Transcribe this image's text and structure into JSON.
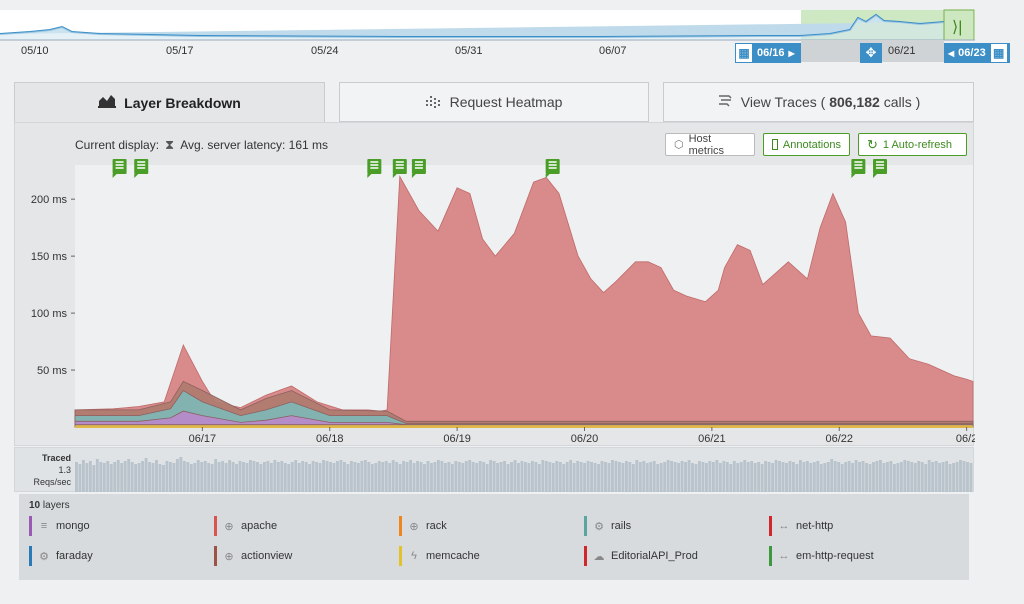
{
  "timeline": {
    "dates": [
      "05/10",
      "05/17",
      "05/24",
      "05/31",
      "06/07",
      "06/21"
    ],
    "range_start": "06/16",
    "range_end": "06/23",
    "expand_icon": "expand-arrows-icon"
  },
  "tabs": [
    {
      "label": "Layer Breakdown",
      "icon": "layers-icon"
    },
    {
      "label": "Request Heatmap",
      "icon": "heatmap-icon"
    },
    {
      "label": "View Traces (",
      "count": "806,182",
      "suffix": "calls )",
      "icon": "traces-icon"
    }
  ],
  "toolbar": {
    "display_label": "Current display:",
    "display_value": "Avg. server latency: 161 ms",
    "host_metrics": "Host metrics",
    "annotations": "Annotations",
    "auto_refresh": "1 Auto-refresh"
  },
  "chart_data": {
    "type": "area",
    "y_ticks": [
      "200 ms",
      "150 ms",
      "100 ms",
      "50 ms"
    ],
    "ylim": [
      0,
      230
    ],
    "x_ticks": [
      "06/17",
      "06/18",
      "06/19",
      "06/20",
      "06/21",
      "06/22",
      "06/2"
    ],
    "series": [
      {
        "name": "apache",
        "color": "#d98a8a",
        "x": [
          0,
          0.3,
          0.5,
          0.7,
          0.85,
          1.0,
          1.1,
          1.3,
          1.5,
          1.7,
          1.9,
          2.1,
          2.2,
          2.3,
          2.4,
          2.45,
          2.55,
          2.7,
          2.85,
          3.0,
          3.1,
          3.2,
          3.3,
          3.45,
          3.6,
          3.7,
          3.8,
          3.95,
          4.05,
          4.15,
          4.25,
          4.4,
          4.5,
          4.6,
          4.7,
          4.8,
          4.95,
          5.05,
          5.1,
          5.2,
          5.3,
          5.4,
          5.5,
          5.6,
          5.75,
          5.85,
          5.95,
          6.05,
          6.15,
          6.25,
          6.4,
          6.55,
          6.7,
          6.8,
          6.9,
          7.0,
          7.05
        ],
        "values": [
          15,
          16,
          18,
          22,
          72,
          40,
          22,
          17,
          28,
          36,
          22,
          15,
          15,
          15,
          14,
          15,
          220,
          190,
          172,
          210,
          205,
          165,
          150,
          170,
          215,
          219,
          205,
          150,
          130,
          118,
          128,
          145,
          145,
          140,
          120,
          115,
          110,
          120,
          140,
          160,
          155,
          125,
          135,
          145,
          130,
          175,
          205,
          180,
          100,
          80,
          78,
          60,
          55,
          50,
          45,
          42,
          40
        ]
      },
      {
        "name": "actionview",
        "color": "#b07b70",
        "x": [
          0,
          0.5,
          0.75,
          0.85,
          1.0,
          1.3,
          1.5,
          1.7,
          2.0,
          2.45,
          2.6,
          7.05
        ],
        "values": [
          15,
          15,
          22,
          40,
          32,
          15,
          25,
          32,
          15,
          14,
          5,
          5
        ]
      },
      {
        "name": "rails",
        "color": "#7fb6b4",
        "x": [
          0,
          0.5,
          0.75,
          0.85,
          1.0,
          1.3,
          1.5,
          1.7,
          2.0,
          2.45,
          2.6,
          7.05
        ],
        "values": [
          10,
          10,
          16,
          32,
          22,
          10,
          15,
          22,
          10,
          10,
          3,
          3
        ]
      },
      {
        "name": "mongo",
        "color": "#b58ac9",
        "x": [
          0,
          0.5,
          0.75,
          0.85,
          1.0,
          1.3,
          1.5,
          1.7,
          2.0,
          2.45,
          2.6,
          7.05
        ],
        "values": [
          5,
          5,
          8,
          14,
          10,
          4,
          6,
          10,
          4,
          4,
          2,
          2
        ]
      },
      {
        "name": "memcache",
        "color": "#e0b84a",
        "x": [
          0,
          7.05
        ],
        "values": [
          2,
          2
        ]
      }
    ],
    "annotation_x": [
      0.35,
      0.52,
      2.35,
      2.55,
      2.7,
      3.75,
      6.15,
      6.32
    ]
  },
  "traced": {
    "label": "Traced",
    "value": "1.3",
    "unit": "Reqs/sec",
    "bars": [
      30,
      28,
      32,
      29,
      31,
      27,
      33,
      30,
      29,
      31,
      28,
      30,
      32,
      29,
      31,
      33,
      30,
      28,
      29,
      31,
      34,
      30,
      29,
      32,
      28,
      27,
      31,
      30,
      29,
      33,
      35,
      31,
      30,
      28,
      29,
      32,
      30,
      31,
      29,
      28,
      33,
      30,
      31,
      29,
      32,
      30,
      28,
      31,
      30,
      29,
      32,
      31,
      30,
      28,
      30,
      31,
      29,
      32,
      30,
      31,
      29,
      28,
      30,
      32,
      29,
      31,
      30,
      28,
      31,
      30,
      29,
      32,
      31,
      30,
      29,
      31,
      32,
      30,
      28,
      31,
      30,
      29,
      31,
      32,
      30,
      28,
      29,
      31,
      30,
      31,
      29,
      32,
      30,
      28,
      31,
      30,
      32,
      29,
      31,
      30,
      28,
      31,
      29,
      30,
      32,
      31,
      29,
      30,
      28,
      31,
      30,
      29,
      31,
      32,
      30,
      29,
      31,
      30,
      28,
      32,
      31,
      29,
      30,
      31,
      28,
      30,
      32,
      29,
      31,
      30,
      29,
      31,
      30,
      28,
      32,
      31,
      30,
      29,
      31,
      30,
      28,
      30,
      32,
      29,
      31,
      30,
      29,
      31,
      30,
      29,
      28,
      31,
      30,
      29,
      32,
      31,
      30,
      29,
      31,
      30,
      28,
      32,
      30,
      31,
      29,
      30,
      31,
      28,
      29,
      30,
      32,
      31,
      30,
      29,
      31,
      30,
      32,
      29,
      28,
      31,
      30,
      29,
      31,
      30,
      32,
      29,
      31,
      30,
      28,
      31,
      29,
      30,
      32,
      30,
      31,
      29,
      30,
      28,
      31,
      30,
      29,
      32,
      31,
      30,
      29,
      31,
      30,
      28,
      32,
      30,
      31,
      29,
      30,
      31,
      28,
      29,
      30,
      33,
      31,
      30,
      28,
      30,
      31,
      29,
      32,
      30,
      31,
      29,
      28,
      30,
      31,
      32,
      29,
      30,
      31,
      28,
      29,
      30,
      32,
      31,
      30,
      29,
      31,
      30,
      28,
      32,
      30,
      31,
      29,
      30,
      31,
      28,
      29,
      30,
      32,
      31,
      30,
      29
    ]
  },
  "legend": {
    "count": "10",
    "count_suffix": "layers",
    "items": [
      {
        "name": "mongo",
        "color": "#9b59b6",
        "icon": "database-icon"
      },
      {
        "name": "apache",
        "color": "#d9534f",
        "icon": "globe-icon"
      },
      {
        "name": "rack",
        "color": "#f0851e",
        "icon": "globe-icon"
      },
      {
        "name": "rails",
        "color": "#5aa5a0",
        "icon": "gears-icon"
      },
      {
        "name": "net-http",
        "color": "#d0262c",
        "icon": "arrows-h-icon"
      },
      {
        "name": "faraday",
        "color": "#2a7ab8",
        "icon": "gears-icon"
      },
      {
        "name": "actionview",
        "color": "#9c5246",
        "icon": "globe-icon"
      },
      {
        "name": "memcache",
        "color": "#e2c12b",
        "icon": "bolt-icon"
      },
      {
        "name": "EditorialAPI_Prod",
        "color": "#d0262c",
        "icon": "cloud-icon"
      },
      {
        "name": "em-http-request",
        "color": "#3c9a3c",
        "icon": "arrows-h-icon"
      }
    ]
  }
}
